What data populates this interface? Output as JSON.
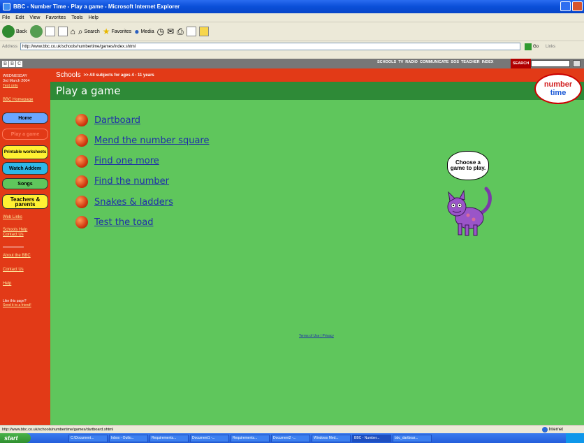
{
  "window": {
    "title": "BBC - Number Time - Play a game - Microsoft Internet Explorer"
  },
  "menu": [
    "File",
    "Edit",
    "View",
    "Favorites",
    "Tools",
    "Help"
  ],
  "toolbar": {
    "back": "Back",
    "search": "Search",
    "favorites": "Favorites",
    "media": "Media"
  },
  "address": {
    "label": "Address",
    "url": "http://www.bbc.co.uk/schools/numbertime/games/index.shtml",
    "go": "Go",
    "links": "Links"
  },
  "bbc": {
    "logo": [
      "B",
      "B",
      "C"
    ],
    "nav": [
      "SCHOOLS",
      "TV",
      "RADIO",
      "COMMUNICATE",
      "SOS",
      "TEACHER",
      "INDEX"
    ],
    "search": "SEARCH"
  },
  "sidebar": {
    "day": "WEDNESDAY",
    "date": "3rd March 2004",
    "text_only": "Text only",
    "homepage": "BBC Homepage",
    "buttons": {
      "home": "Home",
      "play": "Play a game",
      "printable": "Printable worksheets",
      "watch": "Watch Addem",
      "songs": "Songs",
      "teachers": "Teachers & parents"
    },
    "web_links": "Web Links",
    "schools_help": "Schools Help",
    "contact": "Contact Us",
    "about": "About the BBC",
    "contact_us": "Contact Us",
    "help": "Help",
    "like": "Like this page?",
    "send": "Send it to a friend!"
  },
  "header": {
    "schools": "Schools",
    "subjects": ">> All subjects for ages 4 - 11 years",
    "title": "Play a game",
    "logo_1": "number",
    "logo_2": "time"
  },
  "games": [
    "Dartboard",
    "Mend the number square",
    "Find one more",
    "Find the number",
    "Snakes & ladders",
    "Test the toad"
  ],
  "bubble": "Choose a game to play.",
  "footer": "Terms of Use | Privacy",
  "status": {
    "url": "http://www.bbc.co.uk/schools/numbertime/games/dartboard.shtml",
    "zone": "Internet"
  },
  "taskbar": {
    "start": "start",
    "tasks": [
      "C:\\Document...",
      "Inbox - Outlo...",
      "Requirements...",
      "Document1 -...",
      "Requirements...",
      "Document2 -...",
      "Windows Med...",
      "BBC - Number...",
      "bbc_dartboar..."
    ],
    "active_task": 7
  }
}
